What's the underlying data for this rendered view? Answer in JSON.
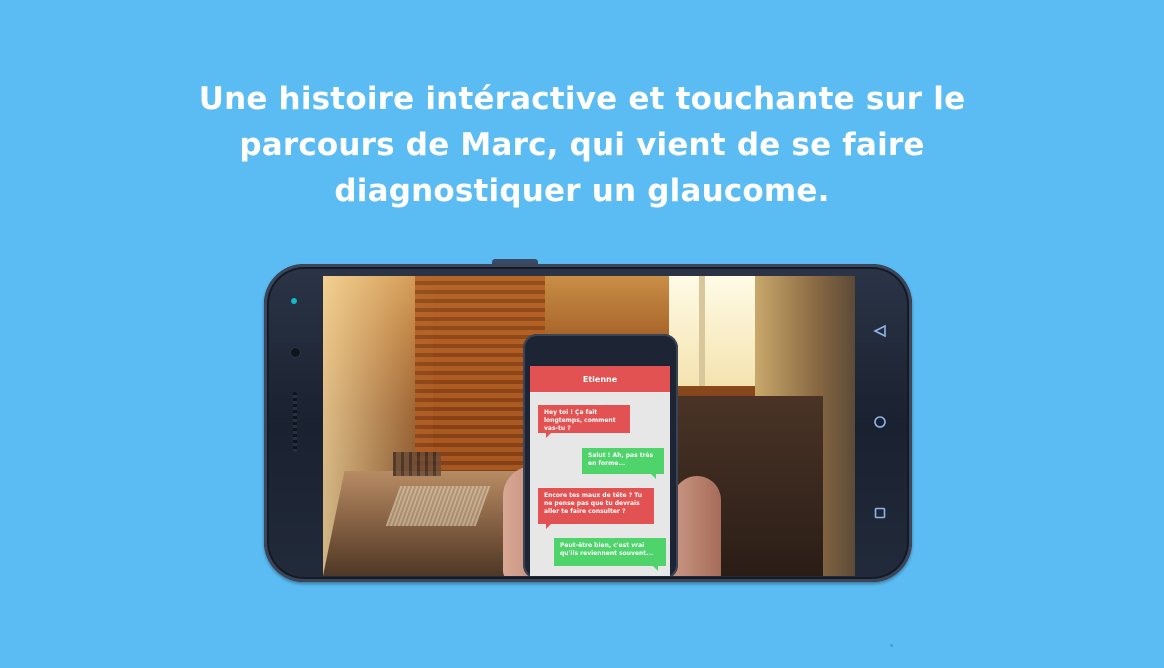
{
  "headline": {
    "line1": "Une histoire intéractive et touchante sur le",
    "line2": "parcours de Marc, qui vient de se faire",
    "line3": "diagnostiquer un glaucome."
  },
  "device": {
    "nav_icons": [
      "back-triangle-icon",
      "home-circle-icon",
      "recents-square-icon"
    ]
  },
  "chat": {
    "contact_name": "Etienne",
    "messages": [
      {
        "side": "left",
        "color": "red",
        "text": "Hey toi ! Ça fait longtemps, comment vas-tu ?"
      },
      {
        "side": "right",
        "color": "green",
        "text": "Salut ! Ah, pas très en forme..."
      },
      {
        "side": "left",
        "color": "red",
        "text": "Encore tes maux de tête ? Tu ne pense pas que tu devrais aller te faire consulter ?"
      },
      {
        "side": "right",
        "color": "green",
        "text": "Peut-être bien, c'est vrai qu'ils reviennent souvent..."
      }
    ]
  },
  "colors": {
    "background": "#5bbcf4",
    "headline_text": "#ffffff",
    "chat_red": "#e35252",
    "chat_green": "#4ed46b"
  }
}
